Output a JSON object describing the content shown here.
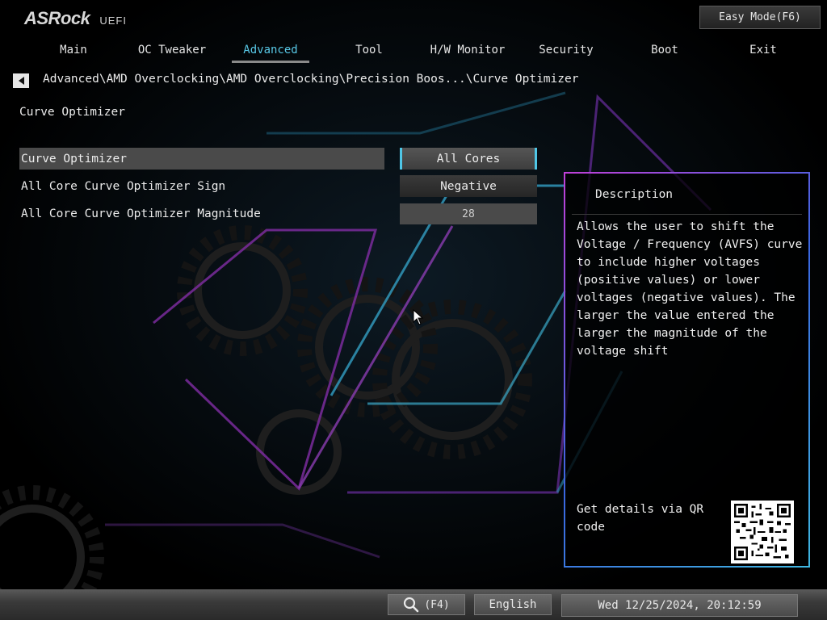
{
  "brand": {
    "logo_text": "ASRock",
    "uefi_label": "UEFI"
  },
  "header": {
    "easy_mode_label": "Easy Mode(F6)"
  },
  "tabs": [
    {
      "label": "Main",
      "active": false
    },
    {
      "label": "OC Tweaker",
      "active": false
    },
    {
      "label": "Advanced",
      "active": true
    },
    {
      "label": "Tool",
      "active": false
    },
    {
      "label": "H/W Monitor",
      "active": false
    },
    {
      "label": "Security",
      "active": false
    },
    {
      "label": "Boot",
      "active": false
    },
    {
      "label": "Exit",
      "active": false
    }
  ],
  "breadcrumb": "Advanced\\AMD Overclocking\\AMD Overclocking\\Precision Boos...\\Curve Optimizer",
  "page_title": "Curve Optimizer",
  "settings": [
    {
      "label": "Curve Optimizer",
      "value": "All Cores",
      "selected": true
    },
    {
      "label": "All Core Curve Optimizer Sign",
      "value": "Negative",
      "selected": false
    },
    {
      "label": "All Core Curve Optimizer Magnitude",
      "value": "28",
      "selected": false
    }
  ],
  "description": {
    "title": "Description",
    "text": "Allows the user to shift the\nVoltage / Frequency (AVFS) curve\nto include higher voltages\n(positive values) or lower\nvoltages (negative values). The\nlarger the value entered the\nlarger the magnitude of the\nvoltage shift",
    "qr_label": "Get details via QR code"
  },
  "footer": {
    "search_key": "(F4)",
    "language": "English",
    "datetime": "Wed 12/25/2024, 20:12:59"
  },
  "colors": {
    "accent": "#4fc6e6",
    "panel_border_start": "#c040d8",
    "panel_border_end": "#3fb6e0"
  },
  "icons": {
    "back": "left-arrow-icon",
    "search": "magnifier-icon",
    "cursor": "mouse-cursor-icon"
  }
}
